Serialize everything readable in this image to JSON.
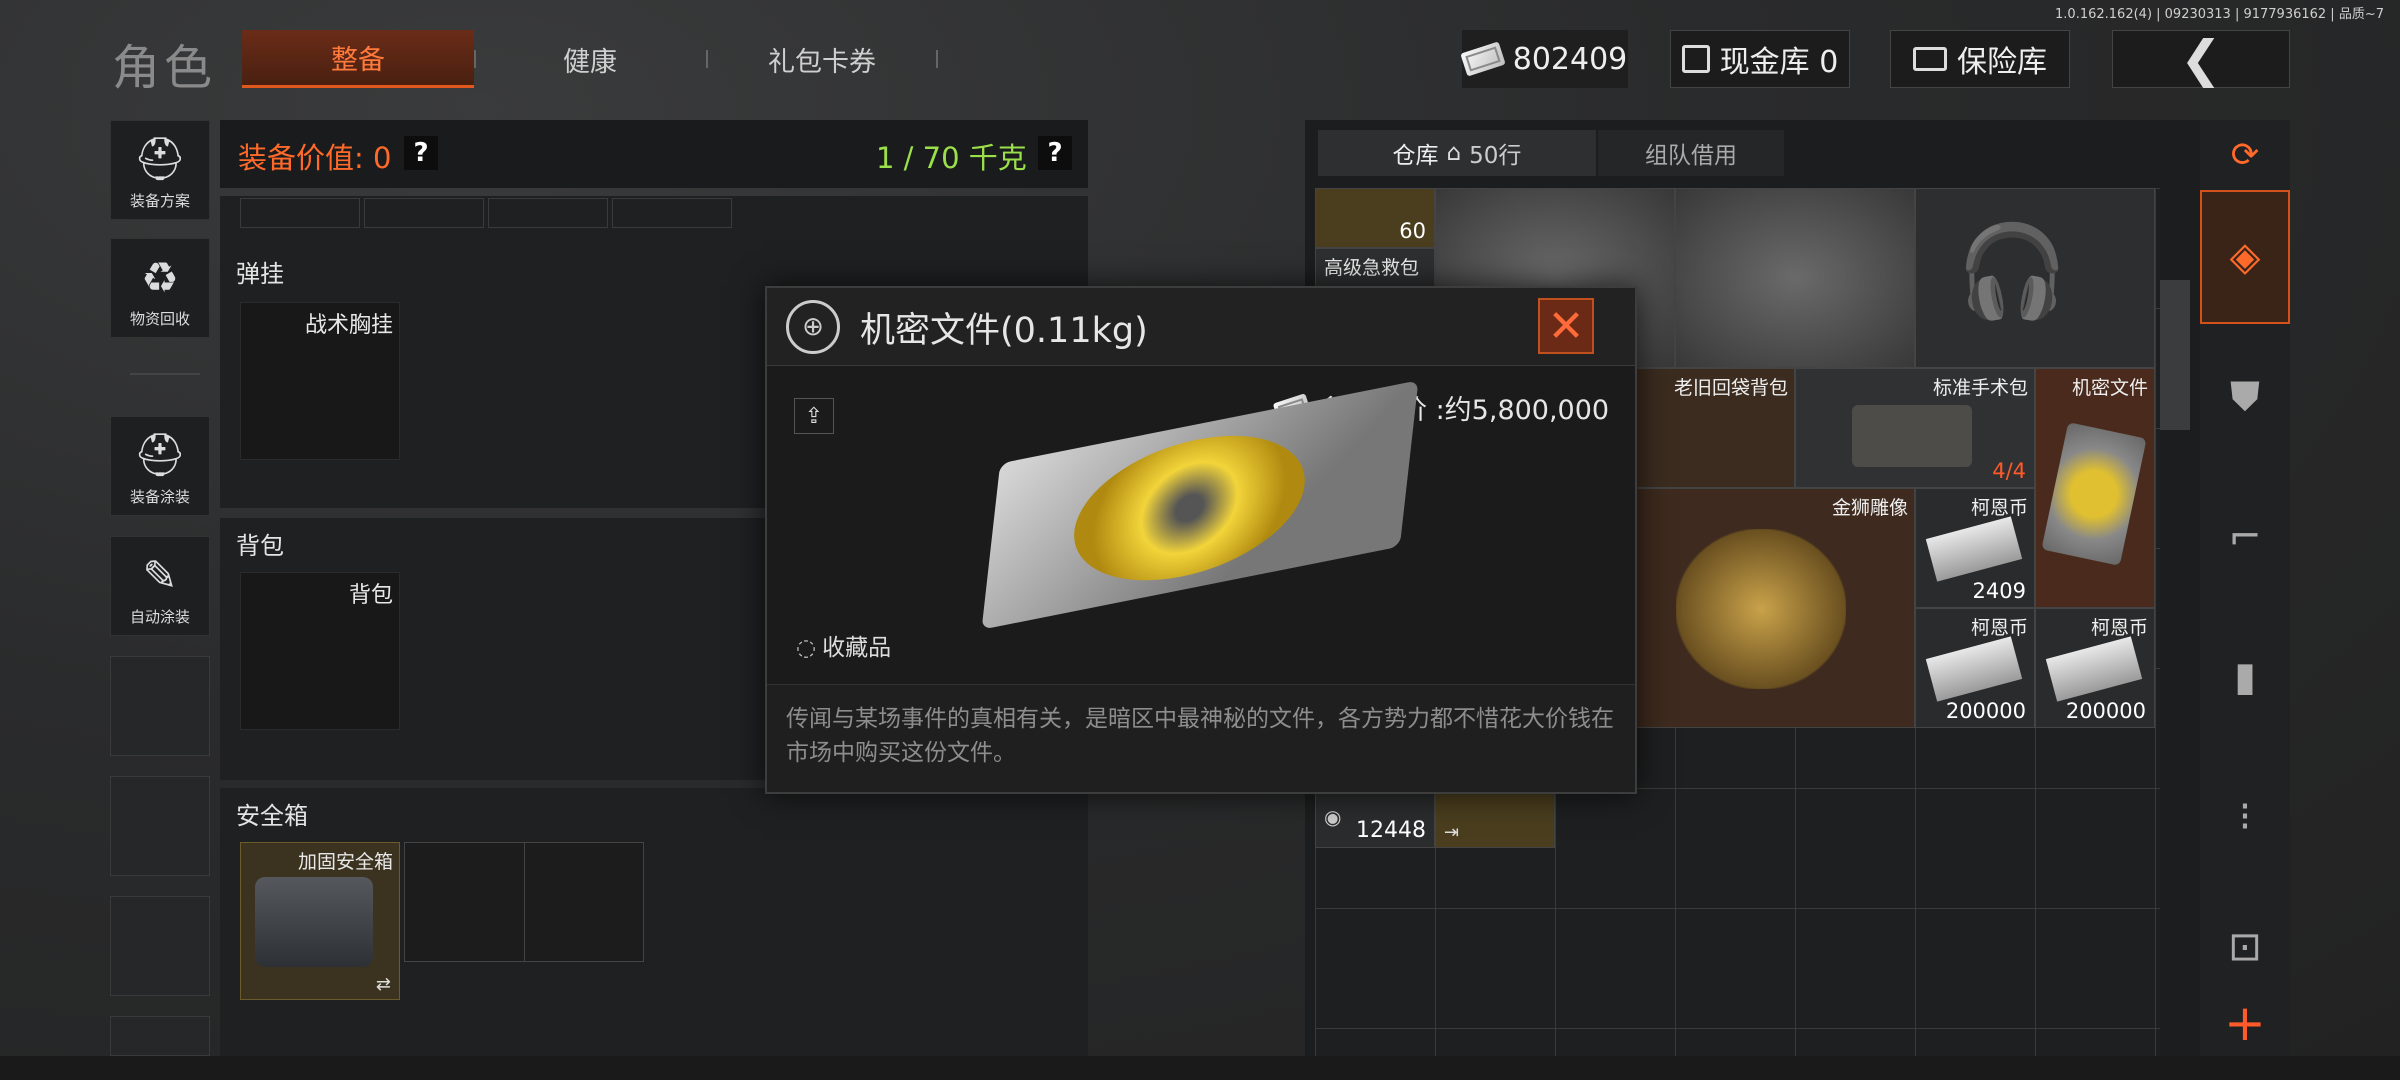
{
  "version": "1.0.162.162(4) | 09230313 | 9177936162 | 品质~7",
  "header": {
    "title": "角色",
    "tabs": [
      "整备",
      "健康",
      "礼包卡券"
    ],
    "currency": "802409",
    "cash_vault": "现金库 0",
    "safe_vault": "保险库"
  },
  "left_menu": [
    "装备方案",
    "物资回收",
    "装备涂装",
    "自动涂装"
  ],
  "equipment": {
    "value_label": "装备价值: 0",
    "help": "?",
    "weight": "1 / 70 千克",
    "sections": {
      "chest_rig": "弹挂",
      "chest_rig_slot": "战术胸挂",
      "backpack": "背包",
      "backpack_slot": "背包",
      "safebox": "安全箱",
      "safebox_slot": "加固安全箱"
    }
  },
  "warehouse": {
    "tabs": [
      "仓库",
      "50行",
      "组队借用"
    ],
    "items": {
      "first_aid_count": "60",
      "first_aid": "高级急救包",
      "old_bag": "老旧回袋背包",
      "surgical_kit": "标准手术包",
      "surgical_kit_count": "4/4",
      "secret_doc": "机密文件",
      "lion": "金狮雕像",
      "coin1": "柯恩币",
      "coin1_count": "2409",
      "coin2": "柯恩币",
      "coin2_count": "200000",
      "coin3": "柯恩币",
      "coin3_count": "200000",
      "other_count": "12448"
    }
  },
  "modal": {
    "title": "机密文件(0.11kg)",
    "price_label": "参考单价 :约5,800,000",
    "category": "收藏品",
    "description": "传闻与某场事件的真相有关，是暗区中最神秘的文件，各方势力都不惜花大价钱在市场中购买这份文件。"
  },
  "colors": {
    "accent": "#e0581e",
    "weight_green": "#9be04a"
  }
}
